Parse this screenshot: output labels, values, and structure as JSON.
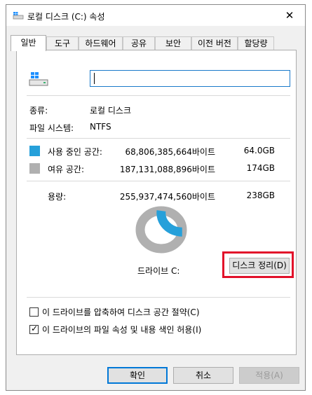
{
  "window": {
    "title": "로컬 디스크 (C:) 속성",
    "close_symbol": "✕"
  },
  "tabs": [
    {
      "label": "일반",
      "active": true
    },
    {
      "label": "도구"
    },
    {
      "label": "하드웨어"
    },
    {
      "label": "공유"
    },
    {
      "label": "보안"
    },
    {
      "label": "이전 버전"
    },
    {
      "label": "할당량"
    }
  ],
  "general": {
    "drive_name_value": "",
    "type_label": "종류:",
    "type_value": "로컬 디스크",
    "fs_label": "파일 시스템:",
    "fs_value": "NTFS",
    "used": {
      "label": "사용 중인 공간:",
      "bytes": "68,806,385,664바이트",
      "size": "64.0GB",
      "color": "#26a0da"
    },
    "free": {
      "label": "여유 공간:",
      "bytes": "187,131,088,896바이트",
      "size": "174GB",
      "color": "#b0b0b0"
    },
    "capacity": {
      "label": "용량:",
      "bytes": "255,937,474,560바이트",
      "size": "238GB"
    },
    "used_fraction": 0.269,
    "drive_label": "드라이브 C:",
    "cleanup_button": "디스크 정리(D)",
    "compress_checkbox": {
      "label": "이 드라이브를 압축하여 디스크 공간 절약(C)",
      "checked": false
    },
    "index_checkbox": {
      "label": "이 드라이브의 파일 속성 및 내용 색인 허용(I)",
      "checked": true,
      "mark": "✓"
    }
  },
  "buttons": {
    "ok": "확인",
    "cancel": "취소",
    "apply": "적용(A)"
  },
  "icons": {
    "title": "drive-icon",
    "drive": "windows-drive-icon"
  },
  "highlight_color": "#e2102a"
}
